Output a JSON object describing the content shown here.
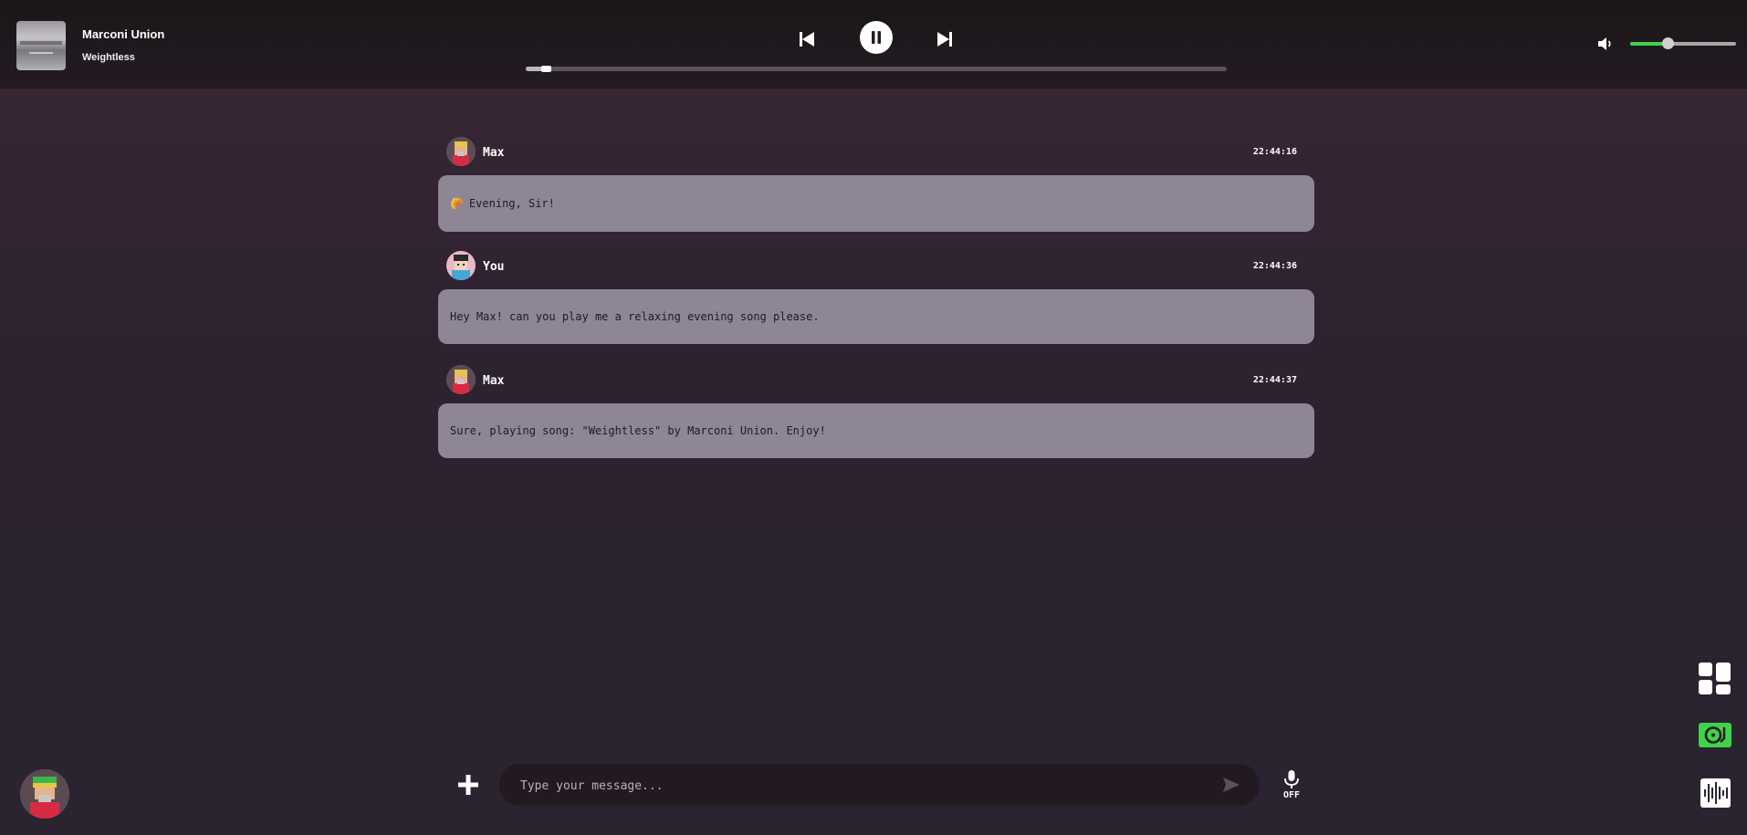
{
  "player": {
    "artist": "Marconi Union",
    "title": "Weightless",
    "progress_fraction": 0.03,
    "volume_fraction": 0.35
  },
  "messages": [
    {
      "sender": "Max",
      "time": "22:44:16",
      "emoji": "🥐",
      "text": "Evening, Sir!"
    },
    {
      "sender": "You",
      "time": "22:44:36",
      "text": "Hey Max! can you play me a relaxing evening song please."
    },
    {
      "sender": "Max",
      "time": "22:44:37",
      "text": "Sure, playing song: \"Weightless\" by Marconi Union. Enjoy!"
    }
  ],
  "composer": {
    "placeholder": "Type your message...",
    "mic_state": "OFF"
  },
  "icons": {
    "prev": "skip-previous-icon",
    "pause": "pause-icon",
    "next": "skip-next-icon",
    "volume": "volume-icon",
    "add": "plus-icon",
    "send": "send-icon",
    "mic": "microphone-icon",
    "grid": "grid-icon",
    "vinyl": "vinyl-record-icon",
    "waveform": "waveform-icon"
  },
  "colors": {
    "accent_green": "#3fd24b",
    "bubble": "#8e8694",
    "background": "#2c2230"
  }
}
